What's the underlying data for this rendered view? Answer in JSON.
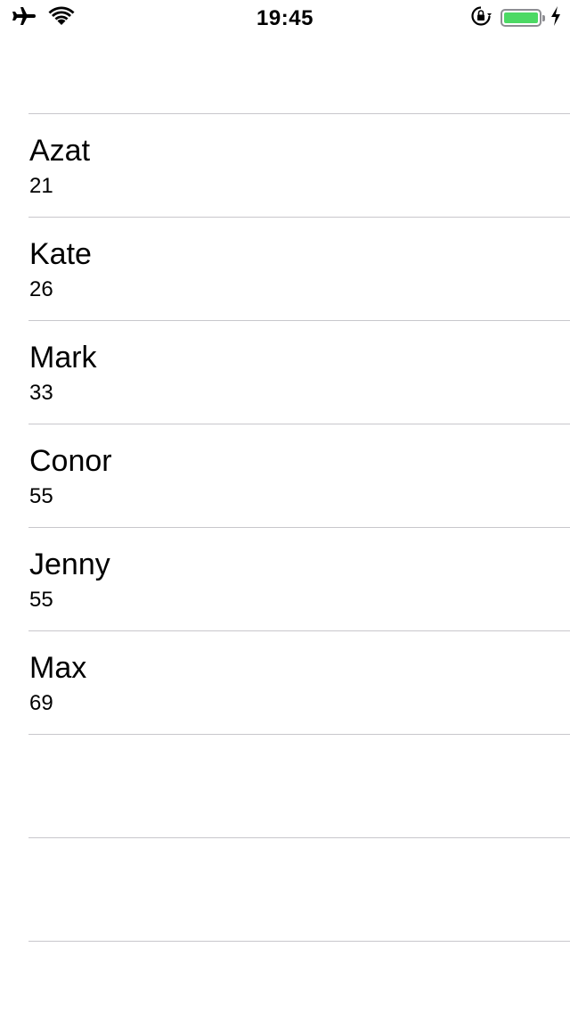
{
  "status_bar": {
    "time": "19:45",
    "battery_color": "#4cd964",
    "battery_level": 1.0,
    "icons": [
      "airplane-icon",
      "wifi-icon",
      "orientation-lock-icon",
      "battery-icon",
      "charging-bolt-icon"
    ]
  },
  "people": [
    {
      "name": "Azat",
      "age": "21"
    },
    {
      "name": "Kate",
      "age": "26"
    },
    {
      "name": "Mark",
      "age": "33"
    },
    {
      "name": "Conor",
      "age": "55"
    },
    {
      "name": "Jenny",
      "age": "55"
    },
    {
      "name": "Max",
      "age": "69"
    }
  ],
  "empty_rows": 2,
  "colors": {
    "separator": "#c8c7cc",
    "text": "#000000",
    "background": "#ffffff"
  }
}
